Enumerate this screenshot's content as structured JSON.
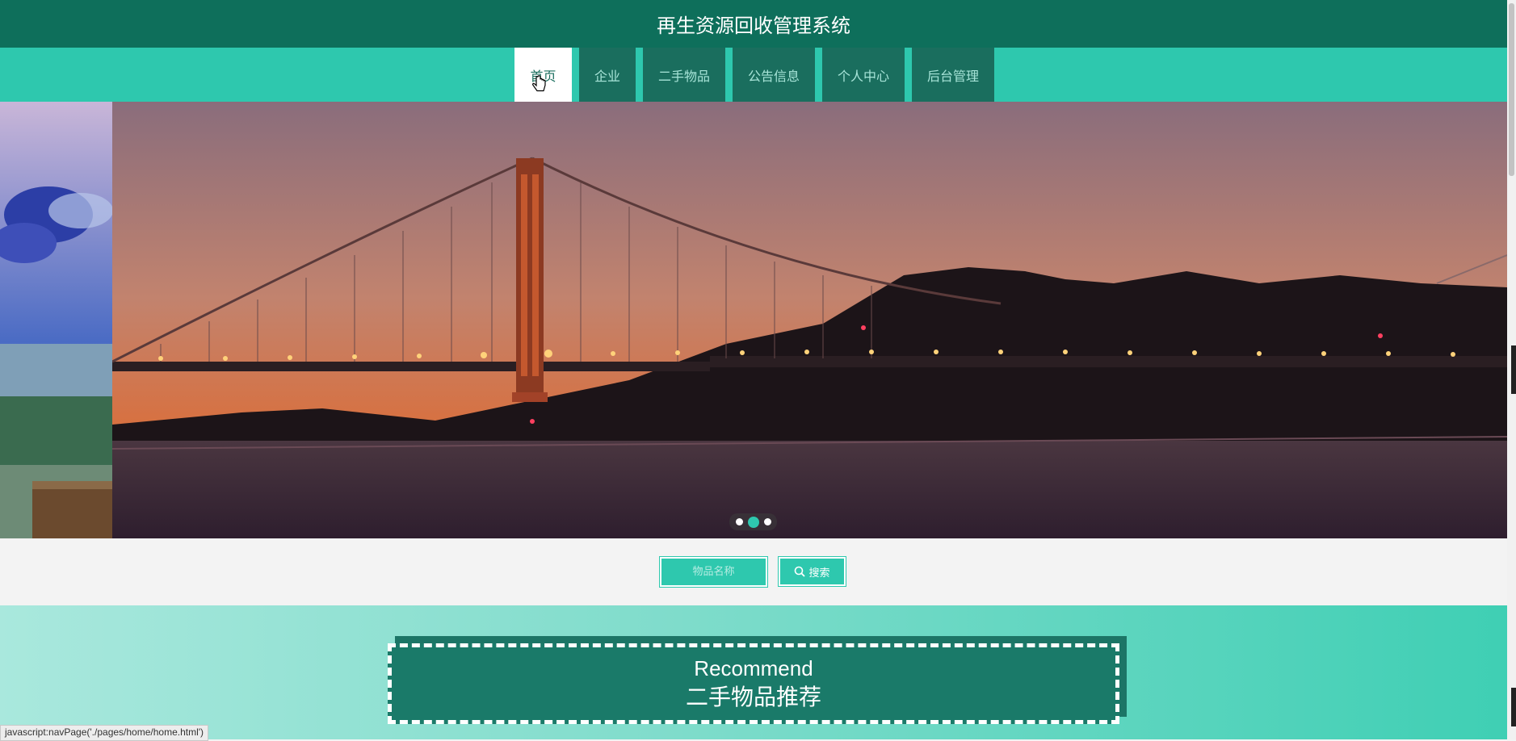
{
  "header": {
    "title": "再生资源回收管理系统"
  },
  "nav": {
    "items": [
      {
        "label": "首页",
        "active": true
      },
      {
        "label": "企业",
        "active": false
      },
      {
        "label": "二手物品",
        "active": false
      },
      {
        "label": "公告信息",
        "active": false
      },
      {
        "label": "个人中心",
        "active": false
      },
      {
        "label": "后台管理",
        "active": false
      }
    ]
  },
  "carousel": {
    "slide_count": 3,
    "active_index": 1
  },
  "search": {
    "placeholder": "物品名称",
    "button_label": "搜索"
  },
  "recommend": {
    "title_en": "Recommend",
    "title_zh": "二手物品推荐"
  },
  "status_bar": {
    "text": "javascript:navPage('./pages/home/home.html')"
  },
  "colors": {
    "header_bg": "#0e6f5b",
    "nav_bg": "#2ec8ae",
    "nav_item_bg": "#1a6e5e",
    "accent": "#2ec8ae"
  }
}
